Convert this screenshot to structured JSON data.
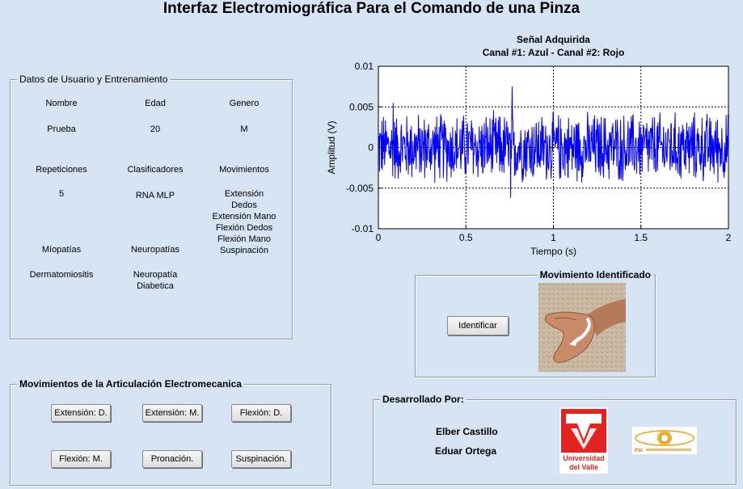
{
  "window": {
    "title": "Interfaz Electromiográfica Para el Comando de una Pinza"
  },
  "user_panel": {
    "title": "Datos de Usuario y Entrenamiento",
    "labels": {
      "nombre": "Nombre",
      "edad": "Edad",
      "genero": "Genero",
      "repeticiones": "Repeticiones",
      "clasificadores": "Clasificadores",
      "movimientos": "Movimientos",
      "miopatias": "Míopatías",
      "neuropatias": "Neuropatías",
      "dermatomiositis": "Dermatomiositis"
    },
    "values": {
      "nombre": "Prueba",
      "edad": "20",
      "genero": "M",
      "repeticiones": "5",
      "clasificadores": "RNA MLP",
      "movimientos": "Extensión\nDedos\nExtensión Mano\nFlexión Dedos\nFlexión Mano\nSuspinación",
      "neuropatia_diabetica": "Neuropatía\nDiabetica"
    }
  },
  "joint_panel": {
    "title": "Movimientos de la Articulación Electromecanica",
    "buttons": [
      "Extensión: D.",
      "Extensión: M.",
      "Flexión: D.",
      "Flexión: M.",
      "Pronación.",
      "Suspinación."
    ]
  },
  "movement_panel": {
    "title": "Movimiento Identificado",
    "identify_button": "Identificar"
  },
  "developers_panel": {
    "title": "Desarrollado Por:",
    "names": [
      "Elber Castillo",
      "Eduar Ortega"
    ],
    "logo_univalle_text": "Universidad del Valle",
    "logo_univalle_lines": [
      "Universidad",
      "del Valle"
    ]
  },
  "chart_data": {
    "type": "line",
    "title": "Señal Adquirida",
    "subtitle": "Canal #1: Azul - Canal #2: Rojo",
    "xlabel": "Tiempo (s)",
    "ylabel": "Amplitud (V)",
    "xlim": [
      0,
      2
    ],
    "ylim": [
      -0.01,
      0.01
    ],
    "xticks": [
      "0",
      "0.5",
      "1",
      "1.5",
      "2"
    ],
    "yticks": [
      "0.01",
      "0.005",
      "0",
      "-0.005",
      "-0.01"
    ],
    "grid": "dashed",
    "series": [
      {
        "color": "#0000ff",
        "peak_amplitude": 0.0075,
        "typical_amplitude": 0.004,
        "x_range": [
          0,
          2
        ]
      }
    ]
  },
  "colors": {
    "background": "#d5e3f2",
    "signal": "#0000ff",
    "univalle_red": "#e3231f"
  }
}
